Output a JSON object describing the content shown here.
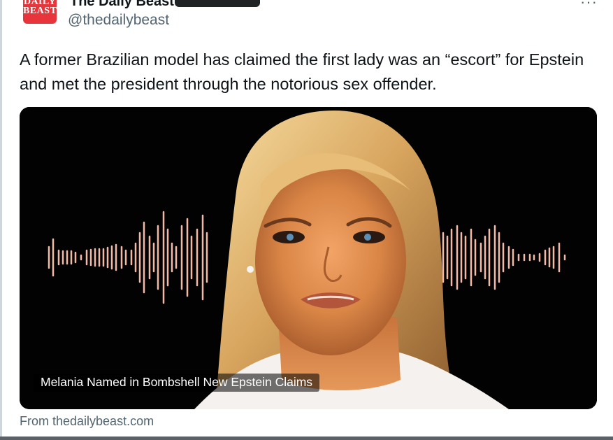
{
  "account": {
    "avatar_line1": "DAILY",
    "avatar_line2": "BEAST",
    "display_name": "The Daily Beast",
    "handle": "@thedailybeast"
  },
  "menu": {
    "more_glyph": "···"
  },
  "tweet": {
    "text": "A former Brazilian model has claimed the first lady was an “escort” for Epstein and met the president through the notorious sex offender."
  },
  "card": {
    "image_caption": "Melania Named in Bombshell New Epstein Claims",
    "source": "From thedailybeast.com"
  },
  "colors": {
    "brand_red": "#e8343b",
    "waveform": "#f4b8a6",
    "card_background": "#020202",
    "secondary_text": "#536471"
  },
  "icons": {
    "more": "more-options-icon",
    "avatar": "daily-beast-logo"
  }
}
